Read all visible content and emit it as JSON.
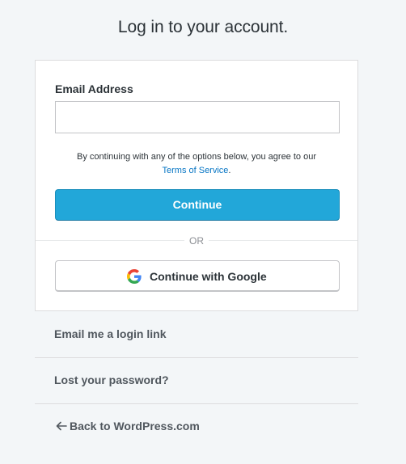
{
  "page": {
    "title": "Log in to your account."
  },
  "login_form": {
    "email_label": "Email Address",
    "email_value": "",
    "email_placeholder": "",
    "terms_prefix": "By continuing with any of the options below, you agree to our",
    "terms_link": "Terms of Service",
    "terms_suffix": ".",
    "continue_label": "Continue",
    "divider_text": "OR",
    "google_label": "Continue with Google",
    "google_icon": "google-g-icon"
  },
  "footer": {
    "login_link": "Email me a login link",
    "lost_password": "Lost your password?",
    "back_label": "Back to WordPress.com",
    "back_icon": "arrow-left-icon"
  },
  "colors": {
    "background": "#f3f6f8",
    "primary_button": "#22a7d9",
    "link": "#0675c4",
    "footer_link": "#50575e"
  }
}
